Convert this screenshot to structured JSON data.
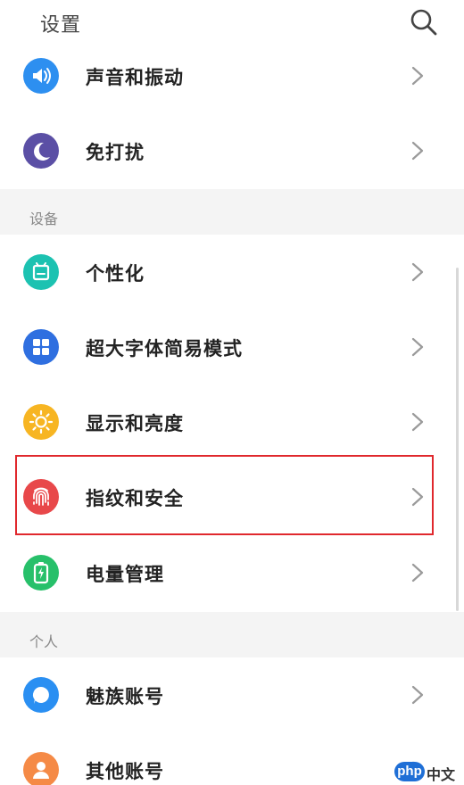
{
  "header": {
    "title": "设置",
    "search_icon": "search-icon"
  },
  "sections": {
    "device_label": "设备",
    "personal_label": "个人"
  },
  "rows": {
    "sound": {
      "label": "声音和振动",
      "icon": "speaker-icon",
      "color": "#2d8ff0"
    },
    "dnd": {
      "label": "免打扰",
      "icon": "moon-icon",
      "color": "#5b4fa5"
    },
    "personalize": {
      "label": "个性化",
      "icon": "theme-icon",
      "color": "#1cc2b1"
    },
    "big_font": {
      "label": "超大字体简易模式",
      "icon": "grid-icon",
      "color": "#2f6fe0"
    },
    "display": {
      "label": "显示和亮度",
      "icon": "sun-icon",
      "color": "#f7b522"
    },
    "fingerprint": {
      "label": "指纹和安全",
      "icon": "fingerprint-icon",
      "color": "#e8484a"
    },
    "battery": {
      "label": "电量管理",
      "icon": "battery-icon",
      "color": "#27c06a"
    },
    "flyme": {
      "label": "魅族账号",
      "icon": "flyme-account-icon",
      "color": "#2a8ff2"
    },
    "other": {
      "label": "其他账号",
      "icon": "person-icon",
      "color": "#f58a46"
    }
  },
  "watermark": {
    "logo_text": "php",
    "site_text": "中文网"
  }
}
